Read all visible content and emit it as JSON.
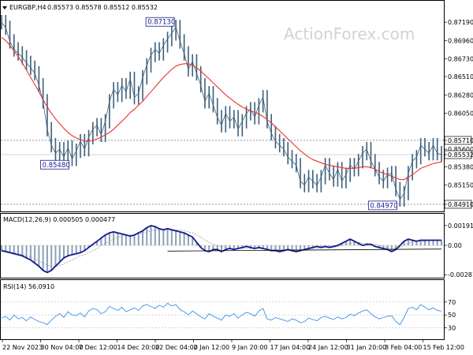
{
  "header": {
    "symbol": "EURGBP,H4",
    "ohlc": "0.85573 0.85578 0.85512 0.85532"
  },
  "watermark": "ActionForex.com",
  "colors": {
    "price": "#3d5f7a",
    "ma": "#e8352b",
    "macd_line": "#141a8c",
    "macd_hist": "#8ca0b8",
    "signal": "#9a9a9a",
    "rsi": "#3c8ee8",
    "frame": "#000000",
    "ref_line": "#555555"
  },
  "chart_data": [
    {
      "type": "line",
      "title": "EURGBP,H4",
      "x_tick_labels": [
        "22 Nov 2023",
        "30 Nov 04:00",
        "7 Dec 12:00",
        "14 Dec 20:00",
        "22 Dec 04:00",
        "2 Jan 12:00",
        "9 Jan 20:00",
        "17 Jan 04:00",
        "24 Jan 12:00",
        "31 Jan 20:00",
        "8 Feb 04:00",
        "15 Feb 12:00"
      ],
      "y_tick_labels": [
        "0.87190",
        "0.86960",
        "0.86730",
        "0.86510",
        "0.86280",
        "0.86050",
        "0.85710",
        "0.85600",
        "0.85532",
        "0.85380",
        "0.85150",
        "0.84910"
      ],
      "ylim": [
        0.8488,
        0.8732
      ],
      "price_label": "0.85532",
      "reference_lines": [
        0.8571,
        0.8491
      ],
      "annotations": [
        {
          "text": "0.87130",
          "index": 42,
          "value": 0.8713
        },
        {
          "text": "0.85480",
          "index": 17,
          "value": 0.8548
        },
        {
          "text": "0.84970",
          "index": 96,
          "value": 0.8497
        }
      ],
      "series": [
        {
          "name": "EURGBP",
          "values": [
            0.8719,
            0.8712,
            0.8695,
            0.8685,
            0.868,
            0.8675,
            0.8668,
            0.8662,
            0.8655,
            0.864,
            0.862,
            0.8585,
            0.8565,
            0.8555,
            0.856,
            0.855,
            0.8562,
            0.8548,
            0.8558,
            0.857,
            0.856,
            0.8575,
            0.8585,
            0.859,
            0.8578,
            0.8595,
            0.862,
            0.8635,
            0.8628,
            0.864,
            0.8632,
            0.8648,
            0.8625,
            0.863,
            0.865,
            0.8665,
            0.8678,
            0.8685,
            0.868,
            0.869,
            0.8698,
            0.8705,
            0.8713,
            0.8695,
            0.868,
            0.866,
            0.867,
            0.8655,
            0.864,
            0.862,
            0.863,
            0.8615,
            0.86,
            0.859,
            0.8605,
            0.8595,
            0.86,
            0.8585,
            0.8595,
            0.8605,
            0.861,
            0.86,
            0.8615,
            0.8625,
            0.8595,
            0.858,
            0.857,
            0.8565,
            0.856,
            0.855,
            0.8545,
            0.854,
            0.852,
            0.8515,
            0.8525,
            0.852,
            0.8515,
            0.8525,
            0.854,
            0.853,
            0.8522,
            0.8535,
            0.852,
            0.8528,
            0.854,
            0.8535,
            0.8545,
            0.8555,
            0.856,
            0.8545,
            0.8535,
            0.8525,
            0.852,
            0.8528,
            0.853,
            0.851,
            0.8497,
            0.8505,
            0.853,
            0.8545,
            0.855,
            0.8565,
            0.856,
            0.8555,
            0.8565,
            0.8555,
            0.8553
          ]
        },
        {
          "name": "MA",
          "values": [
            0.87,
            0.8696,
            0.869,
            0.8683,
            0.8676,
            0.8668,
            0.8659,
            0.865,
            0.8641,
            0.8632,
            0.8622,
            0.8613,
            0.8605,
            0.8598,
            0.8592,
            0.8586,
            0.8581,
            0.8577,
            0.8574,
            0.8572,
            0.857,
            0.857,
            0.8571,
            0.8573,
            0.8575,
            0.8578,
            0.8581,
            0.8585,
            0.859,
            0.8595,
            0.86,
            0.8606,
            0.861,
            0.8615,
            0.862,
            0.8626,
            0.8632,
            0.8638,
            0.8644,
            0.865,
            0.8655,
            0.866,
            0.8664,
            0.8666,
            0.8667,
            0.8667,
            0.8665,
            0.8662,
            0.8658,
            0.8653,
            0.8648,
            0.8643,
            0.8638,
            0.8633,
            0.8628,
            0.8624,
            0.862,
            0.8616,
            0.8613,
            0.861,
            0.8608,
            0.8606,
            0.8604,
            0.8601,
            0.8597,
            0.8593,
            0.8588,
            0.8583,
            0.8578,
            0.8573,
            0.8568,
            0.8563,
            0.8558,
            0.8554,
            0.855,
            0.8547,
            0.8545,
            0.8543,
            0.8541,
            0.854,
            0.8539,
            0.8538,
            0.8537,
            0.8536,
            0.8536,
            0.8536,
            0.8537,
            0.8538,
            0.8538,
            0.8537,
            0.8535,
            0.8532,
            0.853,
            0.8528,
            0.8526,
            0.8524,
            0.8522,
            0.8522,
            0.8525,
            0.8528,
            0.8532,
            0.8536,
            0.8538,
            0.854,
            0.8542,
            0.8543,
            0.8544
          ]
        }
      ]
    },
    {
      "type": "line",
      "title": "MACD(12,26,9) 0.000505 0.000477",
      "y_tick_labels": [
        "0.001911",
        "0.00",
        "-0.002816"
      ],
      "ylim": [
        -0.00295,
        0.00205
      ],
      "zero": 0.0,
      "series": [
        {
          "name": "MACD",
          "values": [
            -0.0005,
            -0.0006,
            -0.0007,
            -0.0008,
            -0.0009,
            -0.001,
            -0.0012,
            -0.0014,
            -0.0017,
            -0.002,
            -0.0024,
            -0.0026,
            -0.0024,
            -0.002,
            -0.0016,
            -0.0012,
            -0.001,
            -0.0009,
            -0.0008,
            -0.0007,
            -0.0005,
            -0.0002,
            0.0001,
            0.0004,
            0.0007,
            0.001,
            0.0012,
            0.0013,
            0.0012,
            0.0011,
            0.001,
            0.0009,
            0.001,
            0.0012,
            0.0014,
            0.0017,
            0.0019,
            0.0018,
            0.0016,
            0.0015,
            0.0016,
            0.0015,
            0.0014,
            0.0013,
            0.0012,
            0.001,
            0.0008,
            0.0003,
            -0.0002,
            -0.0005,
            -0.0006,
            -0.0004,
            -0.0004,
            -0.0006,
            -0.0004,
            -0.0003,
            -0.0004,
            -0.0003,
            -0.0002,
            -0.0001,
            -0.0002,
            -0.0003,
            -0.0002,
            -0.0003,
            -0.0004,
            -0.0005,
            -0.0005,
            -0.0006,
            -0.0005,
            -0.0004,
            -0.0005,
            -0.0006,
            -0.0005,
            -0.0004,
            -0.0003,
            -0.0002,
            -0.0001,
            -0.0002,
            -0.0001,
            -0.0002,
            -0.0001,
            0.0,
            0.0002,
            0.0004,
            0.0006,
            0.0004,
            0.0002,
            0.0,
            0.0001,
            0.0001,
            -0.0001,
            -0.0002,
            -0.0003,
            -0.0004,
            -0.0006,
            -0.0004,
            0.0,
            0.0004,
            0.0006,
            0.0005,
            0.0004,
            0.0005,
            0.0005,
            0.0005,
            0.0005,
            0.0005,
            0.0005
          ]
        },
        {
          "name": "Signal",
          "values": [
            -0.0004,
            -0.0005,
            -0.0006,
            -0.0007,
            -0.0008,
            -0.0009,
            -0.001,
            -0.0011,
            -0.0013,
            -0.0015,
            -0.0017,
            -0.0019,
            -0.002,
            -0.002,
            -0.0019,
            -0.0018,
            -0.0016,
            -0.0014,
            -0.0012,
            -0.001,
            -0.0009,
            -0.0007,
            -0.0005,
            -0.0003,
            0.0,
            0.0002,
            0.0004,
            0.0006,
            0.0008,
            0.0009,
            0.001,
            0.001,
            0.001,
            0.0011,
            0.0012,
            0.0013,
            0.0014,
            0.0015,
            0.0015,
            0.0015,
            0.0015,
            0.0015,
            0.0015,
            0.0015,
            0.0014,
            0.0013,
            0.0012,
            0.001,
            0.0008,
            0.0005,
            0.0003,
            0.0001,
            0.0,
            -0.0001,
            -0.0002,
            -0.0003,
            -0.0003,
            -0.0003,
            -0.0003,
            -0.0003,
            -0.0003,
            -0.0003,
            -0.0003,
            -0.0003,
            -0.0003,
            -0.0004,
            -0.0004,
            -0.0004,
            -0.0004,
            -0.0004,
            -0.0004,
            -0.0004,
            -0.0004,
            -0.0004,
            -0.0004,
            -0.0003,
            -0.0003,
            -0.0002,
            -0.0002,
            -0.0002,
            -0.0002,
            -0.0001,
            0.0,
            0.0001,
            0.0002,
            0.0003,
            0.0003,
            0.0002,
            0.0002,
            0.0001,
            0.0001,
            0.0,
            -0.0001,
            -0.0002,
            -0.0003,
            -0.0003,
            -0.0002,
            0.0,
            0.0002,
            0.0003,
            0.0004,
            0.0004,
            0.0004,
            0.0005,
            0.0005,
            0.0005,
            0.0005
          ]
        }
      ],
      "trend_line": [
        [
          40,
          -0.00055
        ],
        [
          106,
          -0.00035
        ]
      ]
    },
    {
      "type": "line",
      "title": "RSI(14) 56.0910",
      "y_tick_labels": [
        "70",
        "50",
        "30"
      ],
      "ylim": [
        15,
        88
      ],
      "levels": [
        70,
        50,
        30
      ],
      "series": [
        {
          "name": "RSI",
          "values": [
            45,
            48,
            42,
            50,
            44,
            46,
            41,
            47,
            43,
            40,
            38,
            35,
            42,
            48,
            52,
            46,
            55,
            50,
            49,
            53,
            47,
            56,
            60,
            58,
            52,
            55,
            63,
            60,
            57,
            62,
            55,
            58,
            61,
            57,
            64,
            66,
            63,
            60,
            65,
            62,
            68,
            64,
            66,
            58,
            55,
            50,
            56,
            52,
            47,
            44,
            52,
            48,
            45,
            42,
            50,
            48,
            52,
            45,
            50,
            54,
            52,
            48,
            56,
            60,
            44,
            42,
            46,
            44,
            42,
            40,
            44,
            42,
            38,
            40,
            45,
            43,
            41,
            46,
            48,
            45,
            43,
            47,
            44,
            46,
            51,
            49,
            53,
            56,
            58,
            52,
            47,
            44,
            46,
            48,
            49,
            40,
            35,
            46,
            60,
            62,
            58,
            66,
            62,
            58,
            61,
            57,
            56
          ]
        }
      ]
    }
  ]
}
